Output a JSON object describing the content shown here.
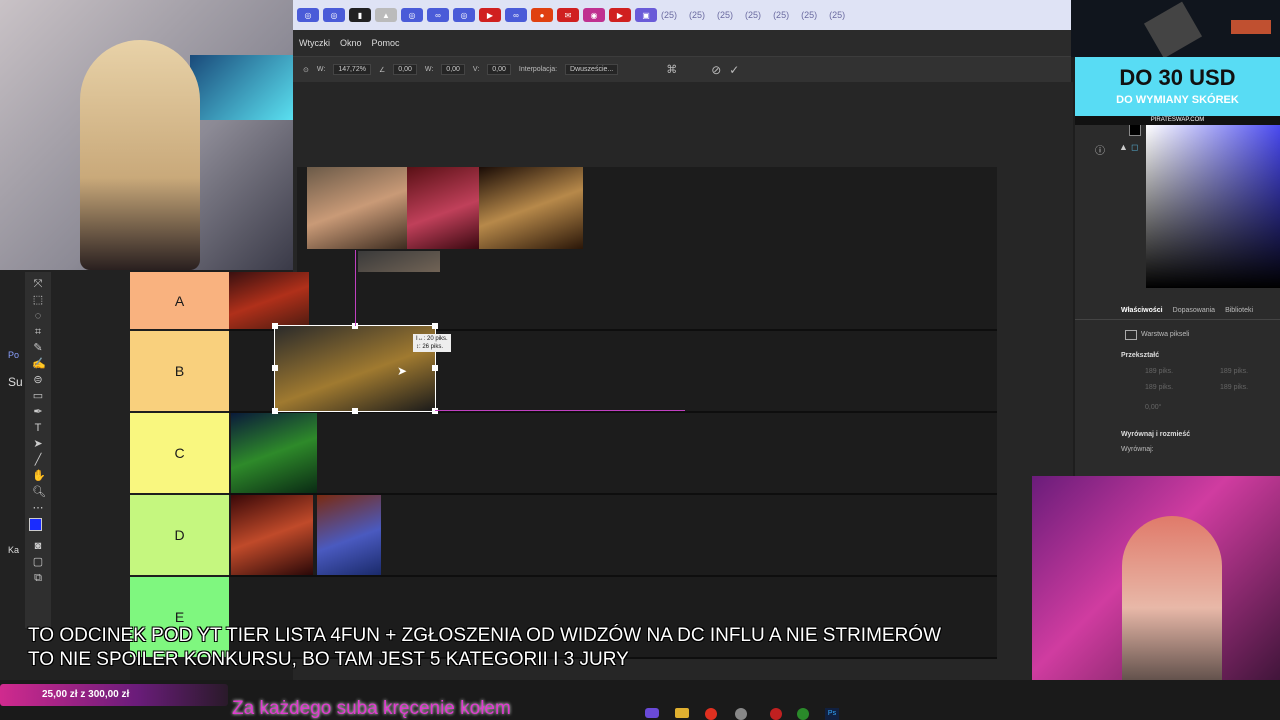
{
  "browser": {
    "tab_counts": [
      "(25)",
      "(25)",
      "(25)",
      "(25)",
      "(25)",
      "(25)",
      "(25)"
    ]
  },
  "photoshop": {
    "menu": [
      "Wtyczki",
      "Okno",
      "Pomoc"
    ],
    "options": {
      "w_label": "W:",
      "w_value": "147,72%",
      "angle_value": "0,00",
      "h_label": "W:",
      "h_value": "0,00",
      "v_label": "V:",
      "v_value": "0,00",
      "interp_label": "Interpolacja:",
      "interp_value": "Dwuszeście..."
    },
    "transform_tooltip": {
      "line1": "I↔: 20 piks.",
      "line2": "↕: 26 piks."
    },
    "panels": {
      "tabs": [
        "Właściwości",
        "Dopasowania",
        "Biblioteki"
      ],
      "layer_type": "Warstwa pikseli",
      "section_transform": "Przekształć",
      "section_align": "Wyrównaj i rozmieść",
      "align_label": "Wyrównaj:",
      "field_px_a": "189 piks.",
      "field_px_b": "189 piks.",
      "field_px_c": "189 piks.",
      "field_px_d": "189 piks.",
      "field_deg": "0,00°"
    }
  },
  "tierlist": {
    "tiers": [
      {
        "label": "A",
        "color": "#f9b27f"
      },
      {
        "label": "B",
        "color": "#f9d07d"
      },
      {
        "label": "C",
        "color": "#f9f77f"
      },
      {
        "label": "D",
        "color": "#c5f77f"
      },
      {
        "label": "E",
        "color": "#7ff77f"
      }
    ]
  },
  "ad": {
    "headline": "DO 30 USD",
    "subline": "DO WYMIANY SKÓREK",
    "site": "PIRATESWAP.COM"
  },
  "overlay": {
    "line1": "TO ODCINEK POD YT TIER LISTA 4FUN + ZGŁOSZENIA OD WIDZÓW NA DC INFLU A NIE STRIMERÓW",
    "line2": "TO NIE SPOILER KONKURSU, BO TAM JEST 5 KATEGORII I 3 JURY"
  },
  "donation": {
    "text": "25,00 zł z 300,00 zł"
  },
  "sub_message": "Za każdego suba kręcenie kołem",
  "left_sidebar": {
    "frag1": "Po",
    "frag2": "Su",
    "frag3": "Ka"
  },
  "colors": {
    "accent_pink": "#e03ad0",
    "ad_bg": "#58dcf4",
    "selection": "#ffffff"
  }
}
